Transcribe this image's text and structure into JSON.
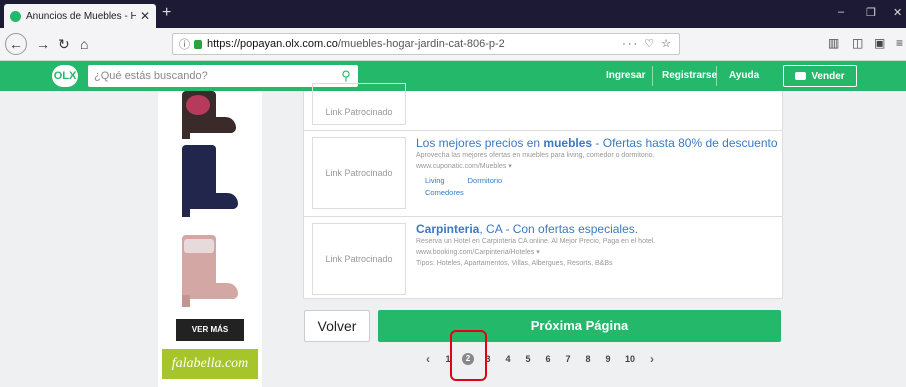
{
  "browser": {
    "tab_title": "Anuncios de Muebles - Hogar",
    "new_tab_label": "+",
    "url_domain": "https://popayan.olx.com.co",
    "url_path": "/muebles-hogar-jardin-cat-806-p-2",
    "window_controls": [
      "–",
      "❐",
      "✕"
    ],
    "toolbar_icons": [
      "library-icon",
      "sidebar-icon",
      "screenshot-icon",
      "menu-icon"
    ]
  },
  "header": {
    "logo_text": "OLX",
    "search_placeholder": "¿Qué estás buscando?",
    "links": [
      "Ingresar",
      "Registrarse",
      "Ayuda"
    ],
    "sell_button": "Vender",
    "accent_color": "#23b86a"
  },
  "left_ad": {
    "cta": "VER MÁS",
    "brand": "falabella.com"
  },
  "listings": [
    {
      "placeholder": "Link Patrocinado",
      "title_pre": "",
      "title_bold": "",
      "title_post": "",
      "desc": "",
      "url": "",
      "sitelinks": []
    },
    {
      "placeholder": "Link Patrocinado",
      "title_pre": "Los mejores precios en ",
      "title_bold": "muebles",
      "title_post": " - Ofertas hasta 80% de descuento",
      "desc": "Aprovecha las mejores ofertas en muebles para living, comedor o dormitorio.",
      "url": "www.cuponatic.com/Muebles ▾",
      "sitelinks": [
        "Living",
        "Dormitorio",
        "Comedores"
      ]
    },
    {
      "placeholder": "Link Patrocinado",
      "title_pre": "",
      "title_bold": "Carpinteria",
      "title_post": ", CA - Con ofertas especiales.",
      "desc": "Reserva un Hotel en Carpinteria CA online. Al Mejor Precio, Paga en el hotel.",
      "url": "www.booking.com/Carpinteria/Hoteles ▾",
      "extra": "Tipos: Hoteles, Apartamentos, Villas, Albergues, Resorts, B&Bs",
      "sitelinks": []
    }
  ],
  "nav": {
    "back_button": "Volver",
    "next_button": "Próxima Página"
  },
  "pagination": {
    "prev": "‹",
    "next": "›",
    "pages": [
      "1",
      "2",
      "3",
      "4",
      "5",
      "6",
      "7",
      "8",
      "9",
      "10"
    ],
    "current": "2"
  }
}
